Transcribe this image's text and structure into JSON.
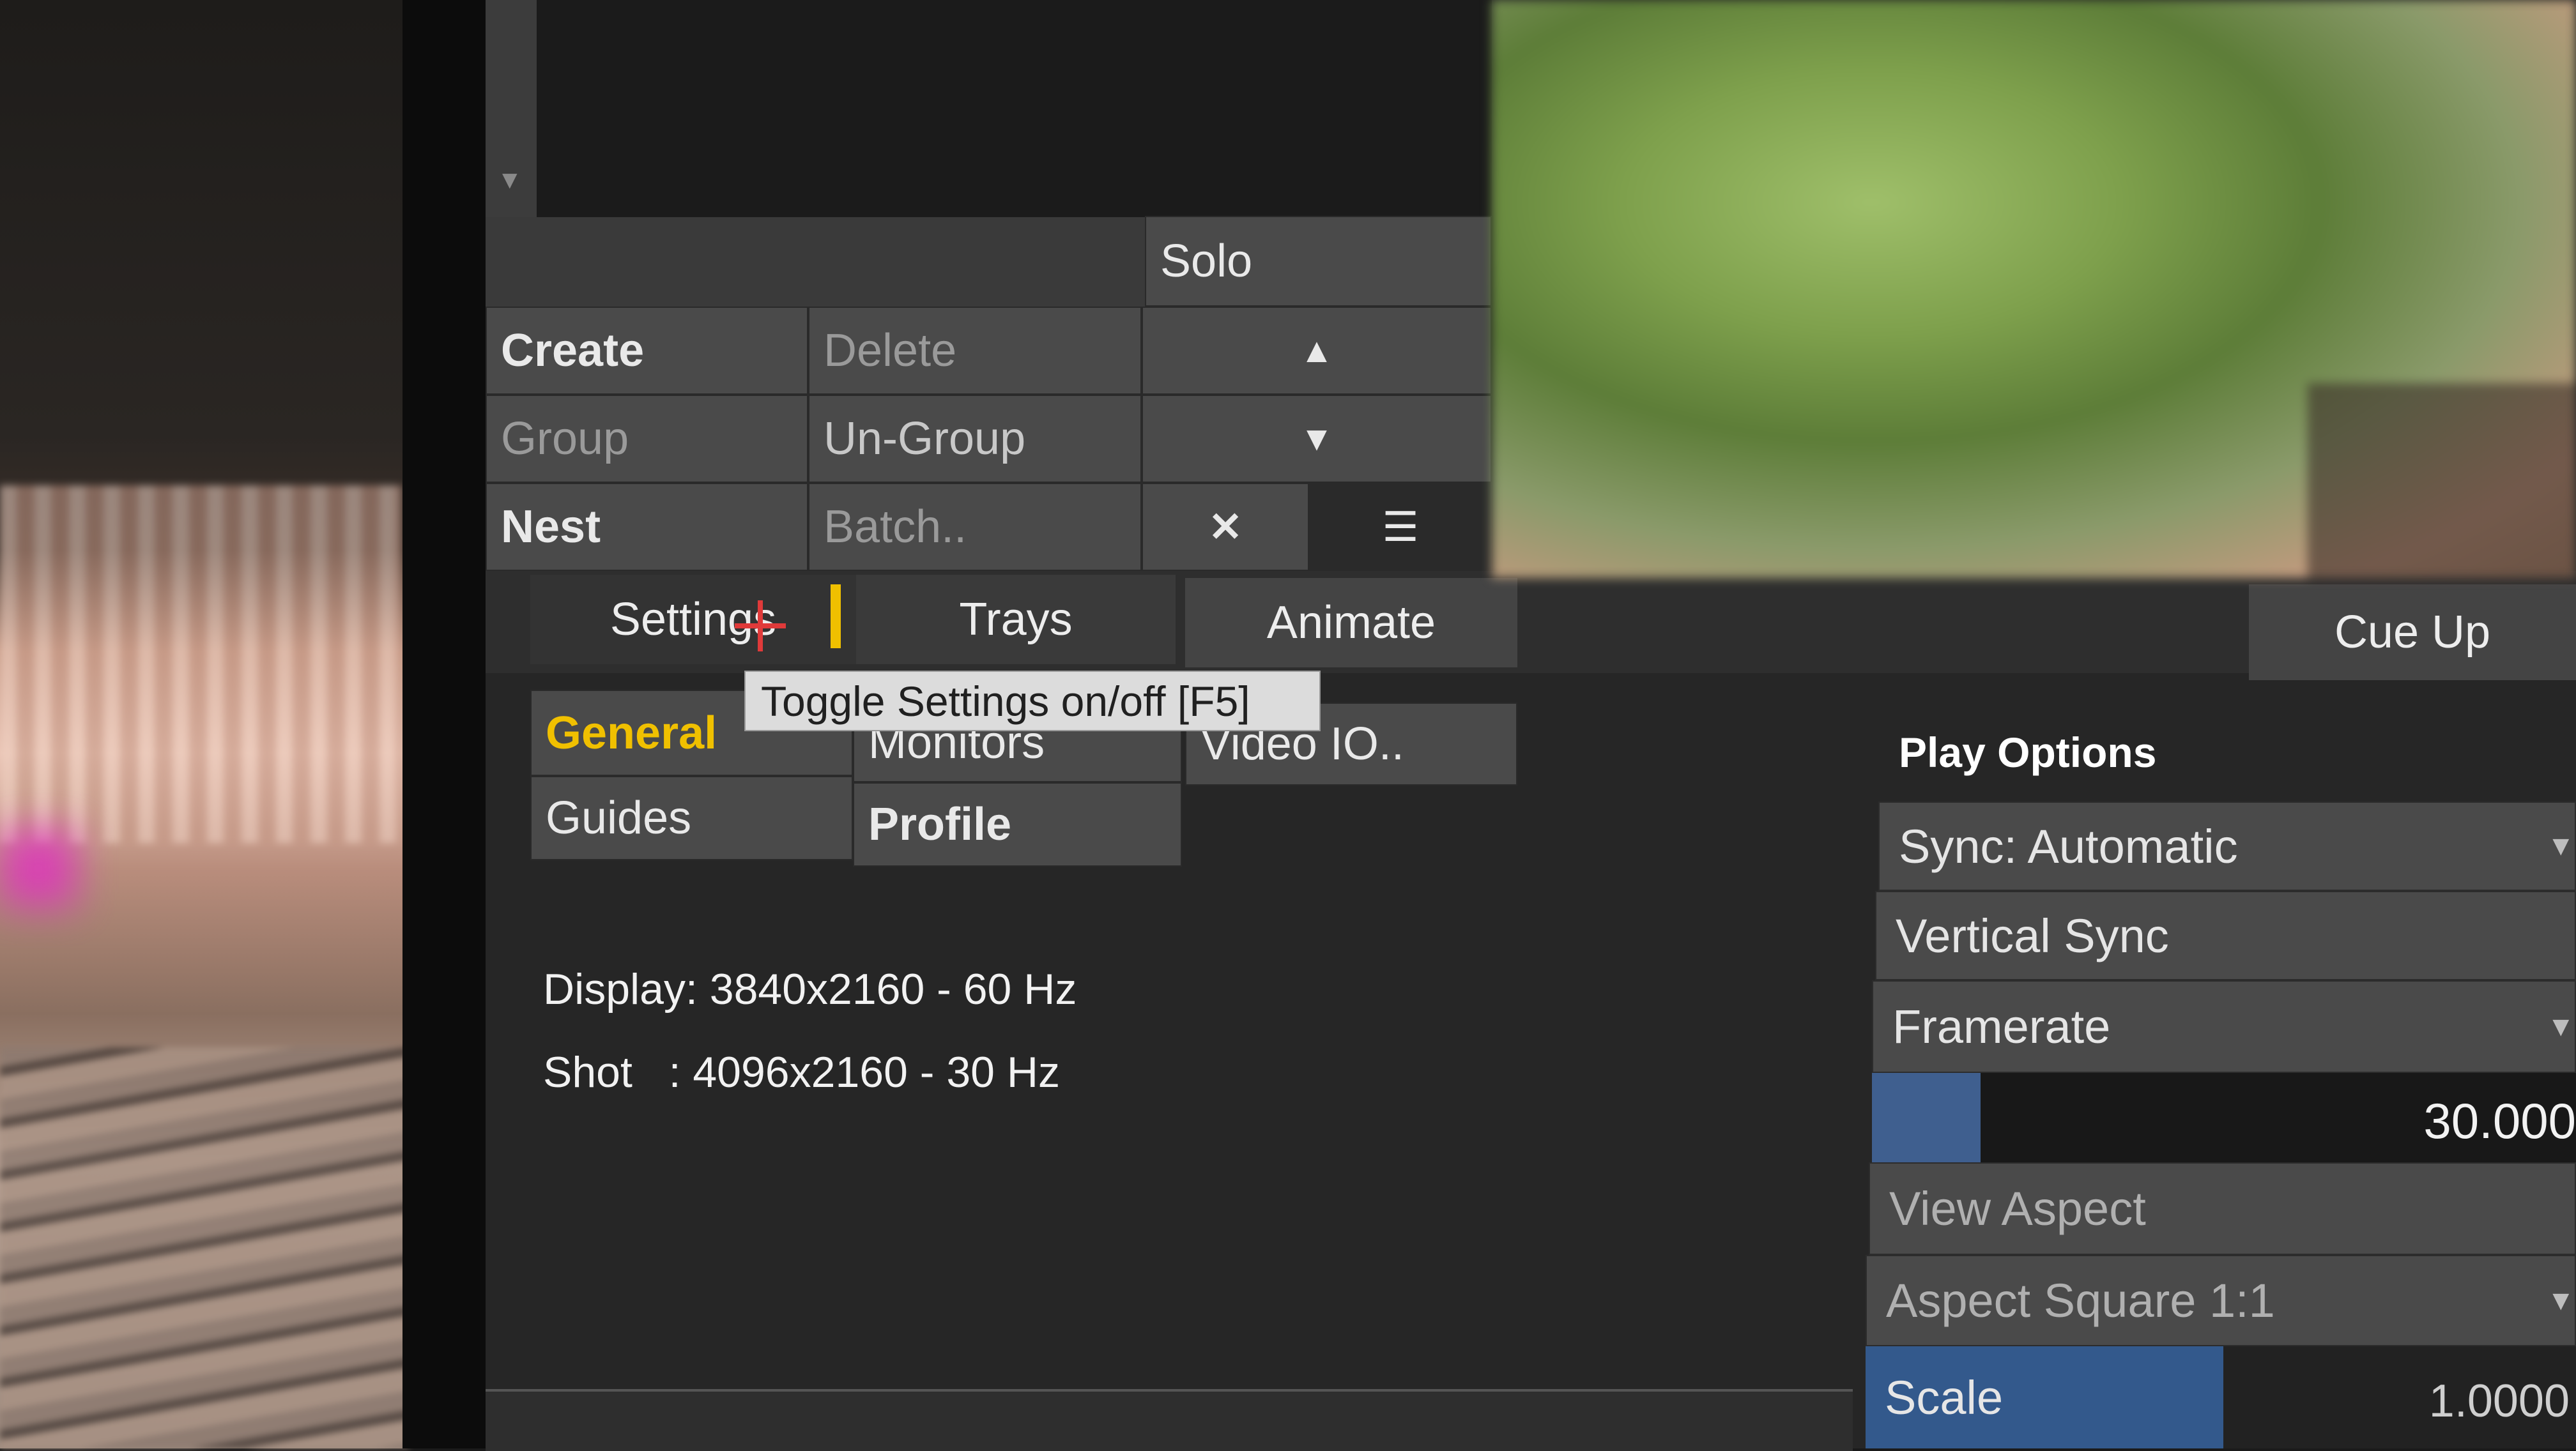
{
  "toolbar": {
    "solo_label": "Solo",
    "create_label": "Create",
    "delete_label": "Delete",
    "group_label": "Group",
    "ungroup_label": "Un-Group",
    "nest_label": "Nest",
    "batch_label": "Batch..",
    "up_arrow": "▲",
    "down_arrow": "▼",
    "close_glyph": "✕",
    "menu_glyph": "☰"
  },
  "tabs": {
    "settings": "Settings",
    "trays": "Trays",
    "animate": "Animate",
    "cue_up": "Cue Up"
  },
  "tooltip": "Toggle Settings on/off [F5]",
  "settings_nav": {
    "general": "General",
    "monitors": "Monitors",
    "video_io": "Video IO..",
    "guides": "Guides",
    "profile": "Profile"
  },
  "info": {
    "display": "Display: 3840x2160 - 60 Hz",
    "shot": "Shot   : 4096x2160 - 30 Hz"
  },
  "play_options": {
    "title": "Play Options",
    "sync": "Sync: Automatic",
    "vertical_sync": "Vertical Sync",
    "framerate": "Framerate",
    "framerate_value": "30.000",
    "view_aspect": "View Aspect",
    "aspect": "Aspect Square 1:1",
    "scale_label": "Scale",
    "scale_value": "1.0000"
  },
  "colors": {
    "accent_yellow": "#f0c000",
    "highlight_blue": "#33598c",
    "panel_gray": "#4a4a4a"
  },
  "icons": [
    "scroll-down-icon",
    "up-arrow-icon",
    "down-arrow-icon",
    "close-icon",
    "menu-icon",
    "cursor-crosshair-icon",
    "dropdown-chevron-icon"
  ]
}
